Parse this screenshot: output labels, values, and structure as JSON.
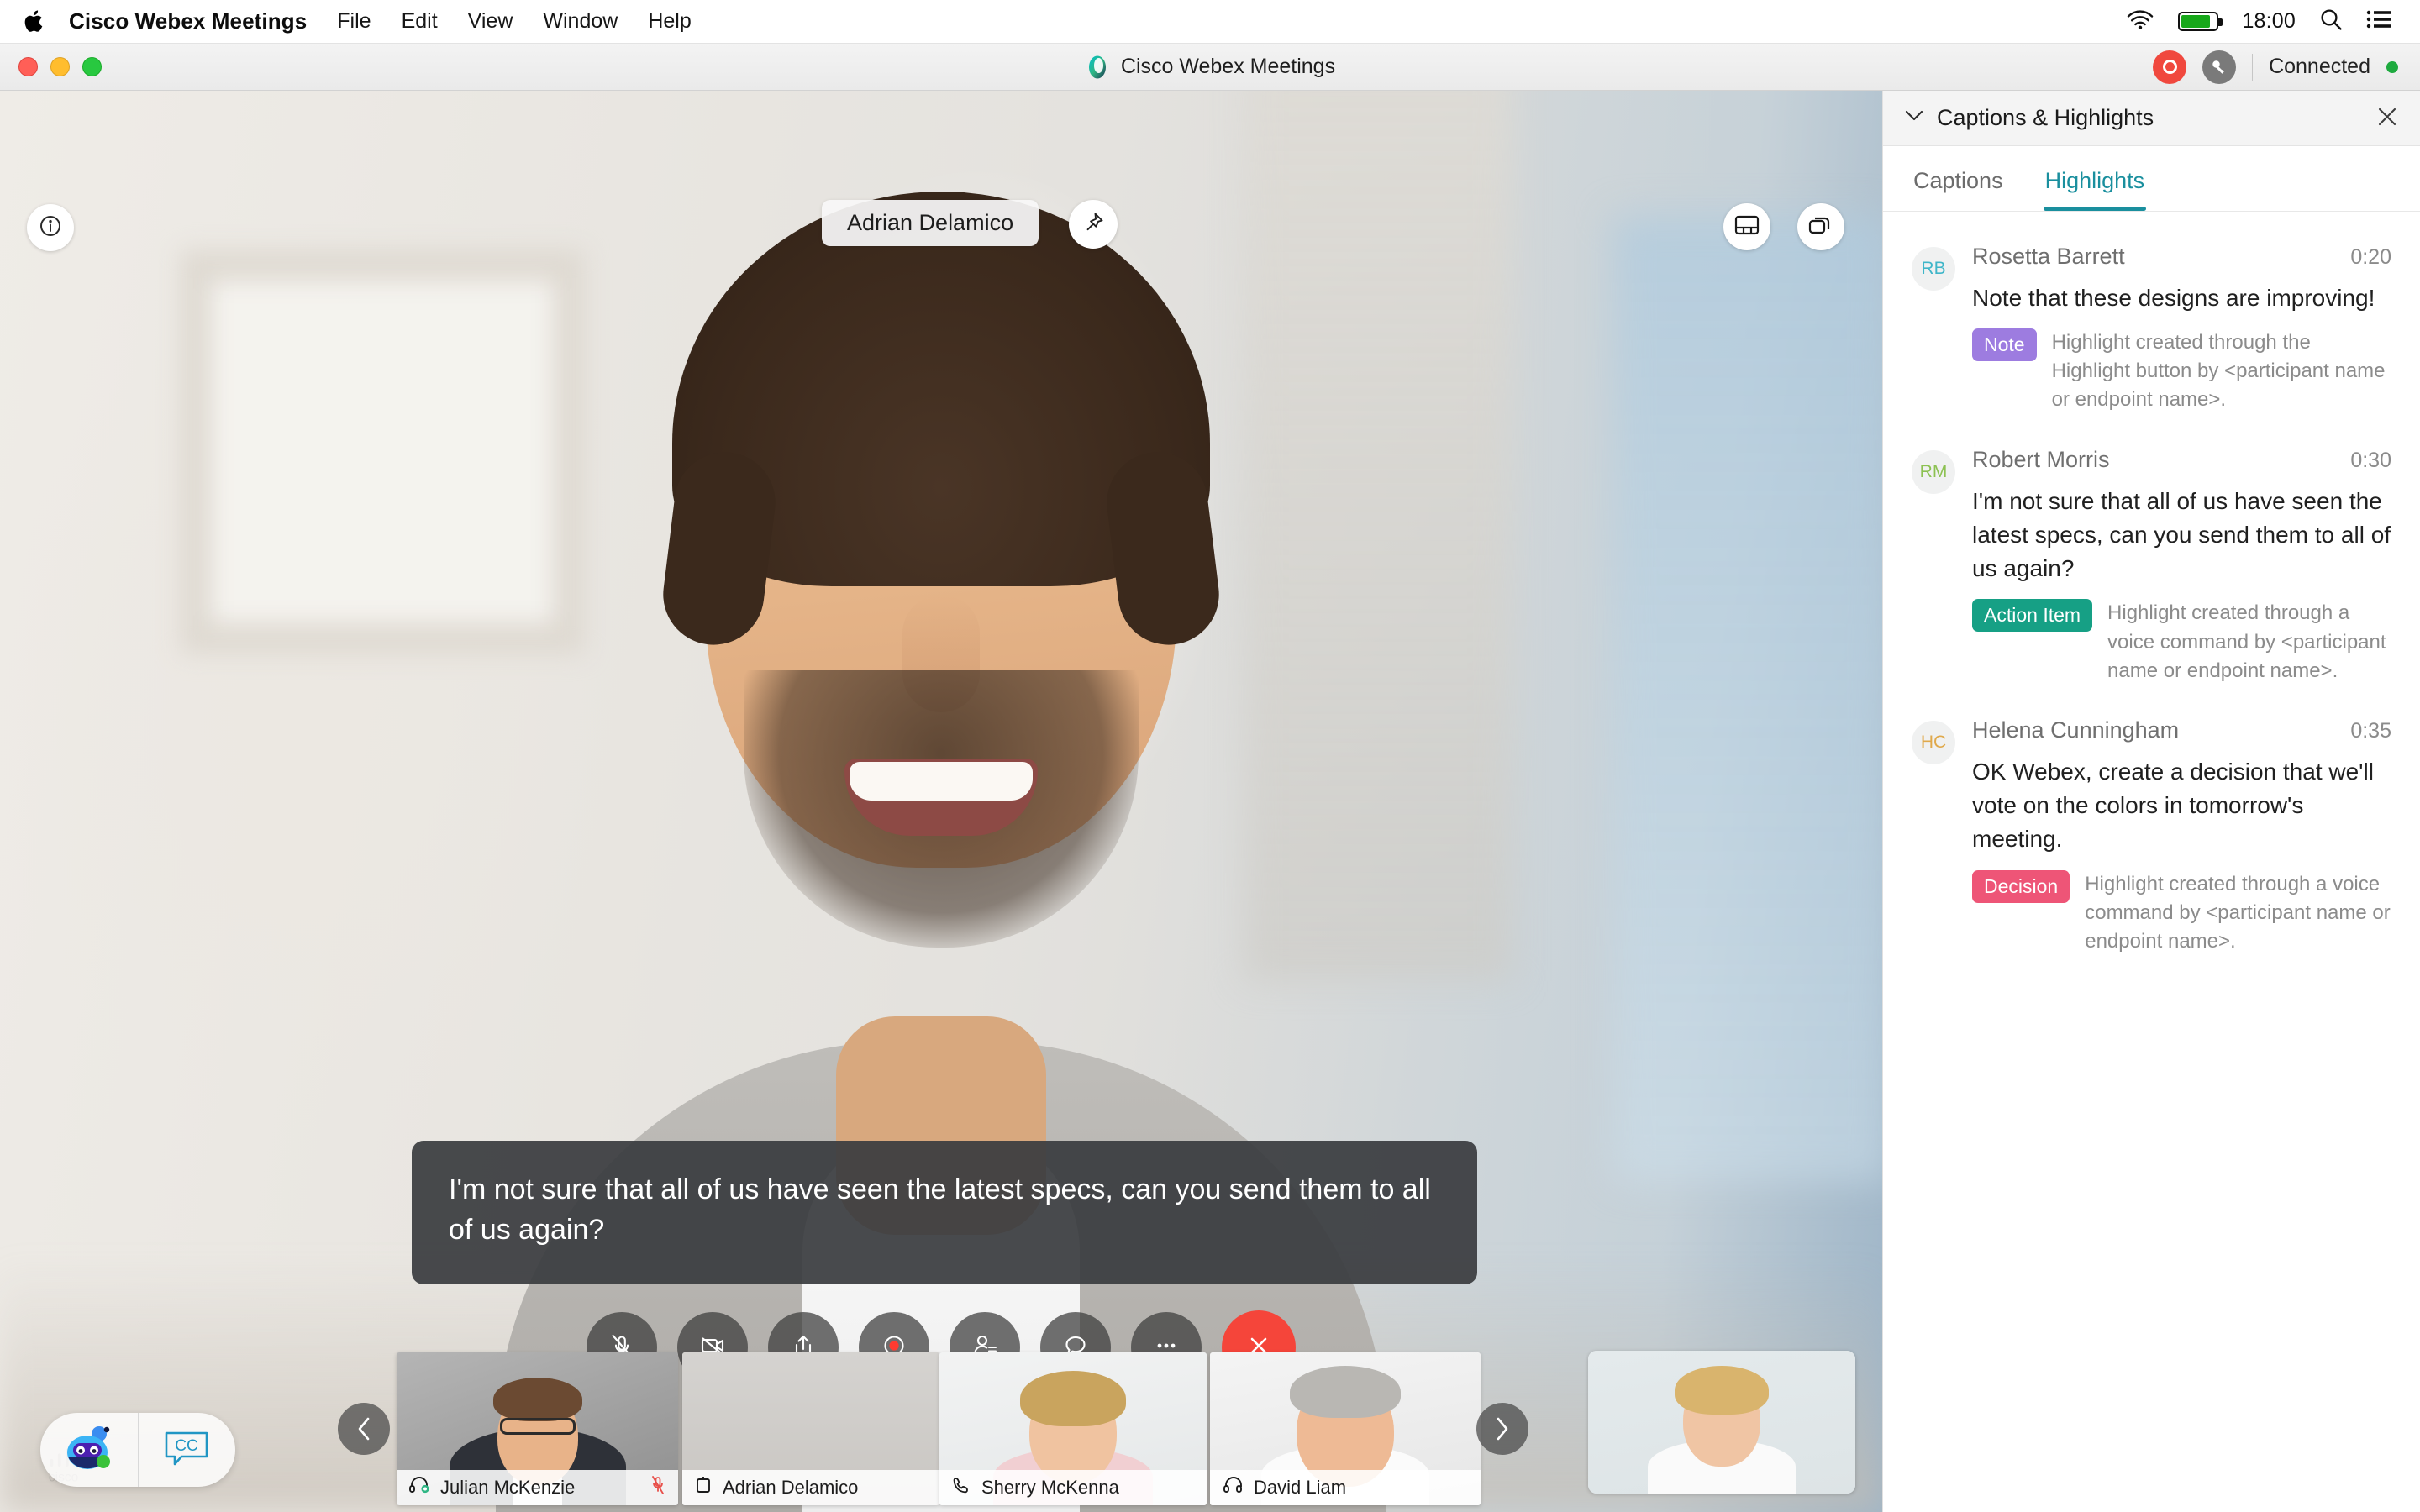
{
  "menubar": {
    "apple_icon": "apple-logo-icon",
    "app_name": "Cisco Webex Meetings",
    "items": [
      "File",
      "Edit",
      "View",
      "Window",
      "Help"
    ],
    "wifi_icon": "wifi-icon",
    "battery_icon": "battery-icon",
    "time": "18:00",
    "search_icon": "search-icon",
    "control_center_icon": "list-icon"
  },
  "titlebar": {
    "window_title": "Cisco Webex Meetings",
    "logo_icon": "webex-logo-icon",
    "record_icon": "record-icon",
    "key_icon": "key-icon",
    "connection_status": "Connected"
  },
  "stage": {
    "info_icon": "info-icon",
    "active_speaker_name": "Adrian Delamico",
    "pin_icon": "pin-icon",
    "layout_icon": "layout-stage-icon",
    "stack_icon": "layout-stack-icon",
    "caption_text": "I'm not sure that all of us have seen the latest specs, can you send them to all of us again?",
    "controls": [
      {
        "name": "mute-audio-button",
        "icon": "microphone-muted-icon",
        "style": "dark"
      },
      {
        "name": "stop-video-button",
        "icon": "camera-off-icon",
        "style": "dark"
      },
      {
        "name": "share-content-button",
        "icon": "share-up-arrow-icon",
        "style": "dark"
      },
      {
        "name": "record-button",
        "icon": "record-circle-icon",
        "style": "dark"
      },
      {
        "name": "participants-button",
        "icon": "participants-icon",
        "style": "dark"
      },
      {
        "name": "chat-button",
        "icon": "chat-bubble-icon",
        "style": "dark"
      },
      {
        "name": "more-options-button",
        "icon": "ellipsis-icon",
        "style": "dark"
      },
      {
        "name": "end-meeting-button",
        "icon": "close-x-icon",
        "style": "red"
      }
    ],
    "filmstrip": {
      "prev_arrow": "chevron-left-icon",
      "next_arrow": "chevron-right-icon",
      "thumbnails": [
        {
          "name": "Julian McKenzie",
          "device_icon": "headset-icon",
          "muted": true,
          "mute_icon": "microphone-muted-icon"
        },
        {
          "name": "Adrian Delamico",
          "device_icon": "device-icon",
          "muted": false
        },
        {
          "name": "Sherry McKenna",
          "device_icon": "phone-icon",
          "muted": false
        },
        {
          "name": "David Liam",
          "device_icon": "headset-icon",
          "muted": false
        },
        {
          "name": "",
          "device_icon": "",
          "muted": false
        }
      ]
    },
    "assistant": {
      "bot_icon": "webex-assistant-bot-icon",
      "cc_icon": "closed-caption-icon",
      "watermark": "cisco"
    }
  },
  "panel": {
    "collapse_icon": "chevron-down-icon",
    "title": "Captions & Highlights",
    "close_icon": "close-icon",
    "tabs": [
      {
        "label": "Captions",
        "active": false
      },
      {
        "label": "Highlights",
        "active": true
      }
    ],
    "highlights": [
      {
        "initials": "RB",
        "initials_color": "#3fb6c9",
        "author": "Rosetta Barrett",
        "time": "0:20",
        "message": "Note that these designs are improving!",
        "chip_label": "Note",
        "chip_color": "#9d7ce0",
        "description": "Highlight created through the Highlight button by <participant name or endpoint name>."
      },
      {
        "initials": "RM",
        "initials_color": "#8cc152",
        "author": "Robert Morris",
        "time": "0:30",
        "message": "I'm not sure that all of us have seen the latest specs, can you send them to all of us again?",
        "chip_label": "Action Item",
        "chip_color": "#16a085",
        "description": "Highlight created through a voice command by <participant name or endpoint name>."
      },
      {
        "initials": "HC",
        "initials_color": "#e0a94b",
        "author": "Helena Cunningham",
        "time": "0:35",
        "message": "OK Webex, create a decision that we'll vote on the colors in tomorrow's meeting.",
        "chip_label": "Decision",
        "chip_color": "#ee5577",
        "description": "Highlight created through a voice command by <participant name or endpoint name>."
      }
    ]
  },
  "colors": {
    "accent_teal": "#1a8f9e",
    "danger_red": "#f5453a",
    "connected_green": "#1eaa3f"
  }
}
